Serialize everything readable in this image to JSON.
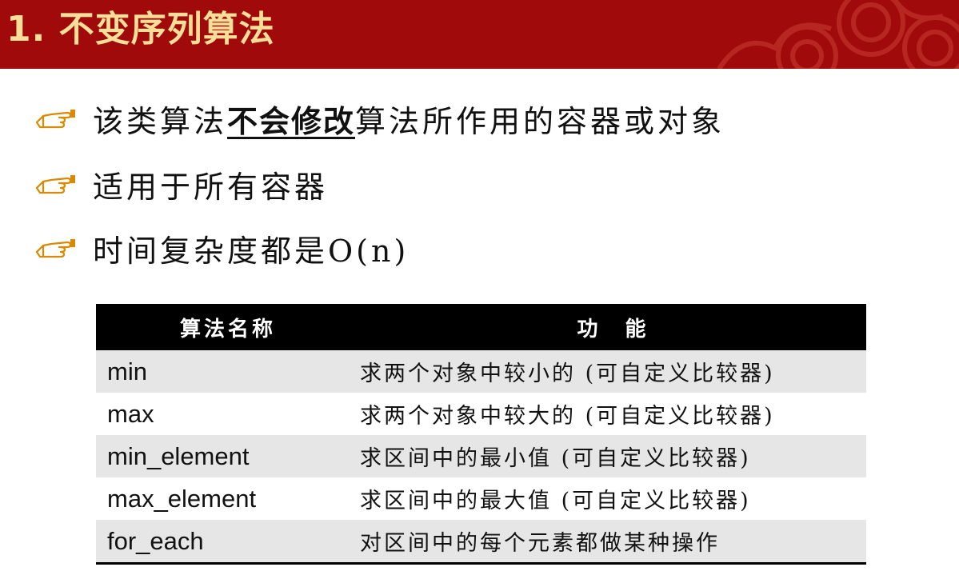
{
  "header": {
    "title": "1. 不变序列算法",
    "bg_color": "#a10a0a",
    "title_color": "#f7df9a"
  },
  "bullets": [
    {
      "icon": "pointing-hand-icon",
      "before": "该类算法",
      "emphasis": "不会修改",
      "after": "算法所作用的容器或对象"
    },
    {
      "icon": "pointing-hand-icon",
      "before": "适用于所有容器",
      "emphasis": "",
      "after": ""
    },
    {
      "icon": "pointing-hand-icon",
      "before": "时间复杂度都是O(n)",
      "emphasis": "",
      "after": ""
    }
  ],
  "table": {
    "headers": [
      "算法名称",
      "功　能"
    ],
    "rows": [
      {
        "name": "min",
        "desc": "求两个对象中较小的 (可自定义比较器)"
      },
      {
        "name": "max",
        "desc": "求两个对象中较大的 (可自定义比较器)"
      },
      {
        "name": "min_element",
        "desc": "求区间中的最小值 (可自定义比较器)"
      },
      {
        "name": "max_element",
        "desc": "求区间中的最大值 (可自定义比较器)"
      },
      {
        "name": "for_each",
        "desc": "对区间中的每个元素都做某种操作"
      }
    ]
  }
}
